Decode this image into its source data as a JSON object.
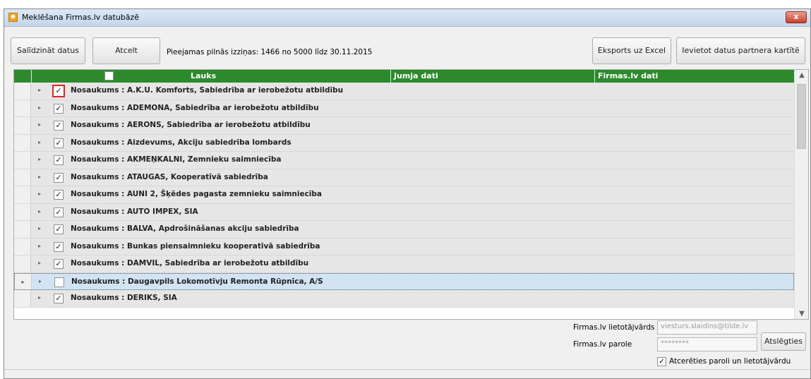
{
  "window": {
    "title": "Meklēšana Firmas.lv datubāzē",
    "close_glyph": "x"
  },
  "toolbar": {
    "compare_label": "Salīdzināt datus",
    "cancel_label": "Atcelt",
    "info_text": "Pieejamas pilnās izziņas: 1466 no 5000 līdz 30.11.2015",
    "export_label": "Eksports uz Excel",
    "insert_label": "Ievietot datus partnera kartītē"
  },
  "grid": {
    "columns": [
      "Lauks",
      "Jumja dati",
      "Firmas.lv dati"
    ],
    "rows": [
      {
        "text": "Nosaukums : A.K.U. Komforts, Sabiedrība ar ierobežotu atbildību",
        "checked": true,
        "highlight": true
      },
      {
        "text": "Nosaukums : ADEMONA, Sabiedrība ar ierobežotu atbildību",
        "checked": true
      },
      {
        "text": "Nosaukums : AERONS, Sabiedrība ar ierobežotu atbildību",
        "checked": true
      },
      {
        "text": "Nosaukums : Aizdevums, Akciju sabiedrība lombards",
        "checked": true
      },
      {
        "text": "Nosaukums : AKMEŅKALNI, Zemnieku saimniecība",
        "checked": true
      },
      {
        "text": "Nosaukums : ATAUGAS, Kooperatīvā sabiedrība",
        "checked": true
      },
      {
        "text": "Nosaukums : AUNI 2, Šķēdes pagasta zemnieku saimniecība",
        "checked": true
      },
      {
        "text": "Nosaukums : AUTO IMPEX, SIA",
        "checked": true
      },
      {
        "text": "Nosaukums : BALVA, Apdrošināšanas akciju sabiedrība",
        "checked": true
      },
      {
        "text": "Nosaukums : Bunkas piensaimnieku kooperatīvā sabiedrība",
        "checked": true
      },
      {
        "text": "Nosaukums : DAMVIL, Sabiedrība ar ierobežotu atbildību",
        "checked": true
      },
      {
        "text": "Nosaukums : Daugavpils Lokomotīvju Remonta Rūpnīca, A/S",
        "checked": false,
        "selected": true
      },
      {
        "text": "Nosaukums : DERIKS, SIA",
        "checked": true
      }
    ]
  },
  "login": {
    "username_label": "Firmas.lv lietotājvārds",
    "username_value": "viesturs.slaidins@tilde.lv",
    "password_label": "Firmas.lv parole",
    "password_value": "********",
    "connect_label": "Atslēgties",
    "remember_label": "Atcerēties paroli un lietotājvārdu",
    "remember_checked": true
  },
  "colors": {
    "header_green": "#2c8a2c",
    "selected_row": "#d2e4f4",
    "highlight_red": "#e02020"
  },
  "icons": {
    "check": "✓",
    "expand": "▸",
    "row_pointer": "▸",
    "scroll_up": "▲",
    "scroll_down": "▼"
  }
}
